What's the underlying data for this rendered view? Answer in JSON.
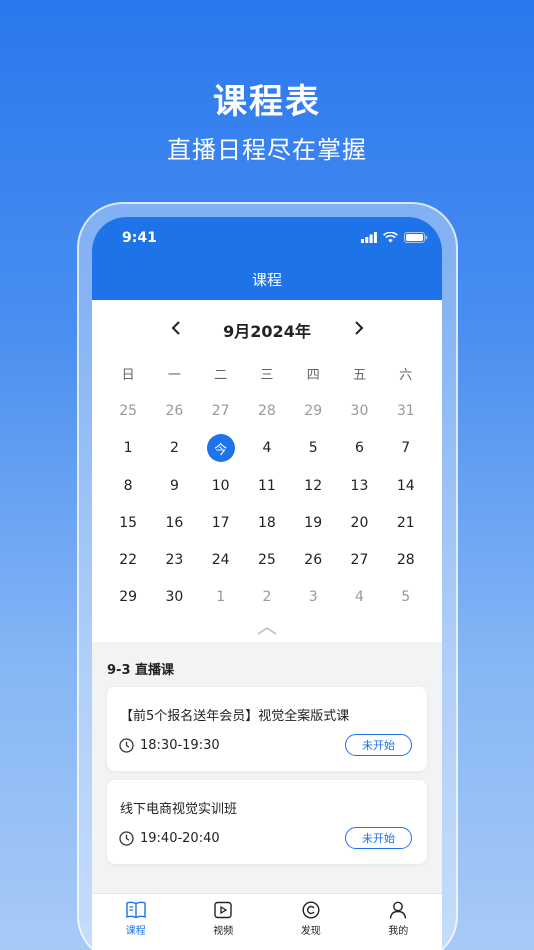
{
  "promo": {
    "title": "课程表",
    "subtitle": "直播日程尽在掌握"
  },
  "status_bar": {
    "time": "9:41"
  },
  "nav": {
    "title": "课程"
  },
  "calendar": {
    "month_label": "9月2024年",
    "weekdays": [
      "日",
      "一",
      "二",
      "三",
      "四",
      "五",
      "六"
    ],
    "weeks": [
      [
        "25",
        "26",
        "27",
        "28",
        "29",
        "30",
        "31"
      ],
      [
        "1",
        "2",
        "今",
        "4",
        "5",
        "6",
        "7"
      ],
      [
        "8",
        "9",
        "10",
        "11",
        "12",
        "13",
        "14"
      ],
      [
        "15",
        "16",
        "17",
        "18",
        "19",
        "20",
        "21"
      ],
      [
        "22",
        "23",
        "24",
        "25",
        "26",
        "27",
        "28"
      ],
      [
        "29",
        "30",
        "1",
        "2",
        "3",
        "4",
        "5"
      ]
    ]
  },
  "schedule": {
    "title": "9-3 直播课",
    "courses": [
      {
        "name": "【前5个报名送年会员】视觉全案版式课",
        "time": "18:30-19:30",
        "status": "未开始"
      },
      {
        "name": "线下电商视觉实训班",
        "time": "19:40-20:40",
        "status": "未开始"
      }
    ]
  },
  "tabbar": {
    "items": [
      {
        "label": "课程",
        "icon": "book-icon",
        "active": true
      },
      {
        "label": "视频",
        "icon": "video-icon",
        "active": false
      },
      {
        "label": "发现",
        "icon": "discover-icon",
        "active": false
      },
      {
        "label": "我的",
        "icon": "user-icon",
        "active": false
      }
    ]
  },
  "colors": {
    "accent": "#1f73e8",
    "muted_text": "#999999"
  }
}
